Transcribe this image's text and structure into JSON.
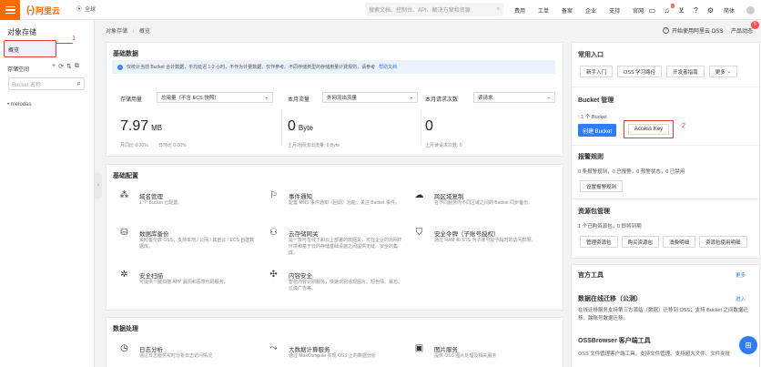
{
  "topbar": {
    "logo_text": "阿里云",
    "region": "全球",
    "search_placeholder": "搜索文档、控制台、API、解决方案和资源",
    "nav": [
      "费用",
      "工单",
      "备案",
      "企业",
      "支持",
      "官网"
    ],
    "notification_count": "1",
    "lang": "简体"
  },
  "sidebar": {
    "title": "对象存储",
    "overview_label": "概览",
    "annotation": "1",
    "bucket_list_label": "存储空间",
    "bucket_search_placeholder": "Bucket 名称",
    "bucket_entry": "melodas"
  },
  "breadcrumb": {
    "root": "对象存储",
    "sep": "/",
    "current": "概览",
    "right_link": "开始使用阿里云 OSS",
    "product_trends": "产品动态",
    "product_badge": "5"
  },
  "basic_data": {
    "title": "基础数据",
    "info": "仅统计当前 Bucket 合计数据，平均延迟 1-2 小时，不作为计量数据，仅作参考。不同存储类型的存储用量计费规则，请参考",
    "info_link": "帮助文档",
    "storage": {
      "label": "存储用量",
      "select": "总用量（不含 ECS 快照）",
      "value": "7.97",
      "unit": "MB",
      "sub1": "月同比 0.00%",
      "sub2": "日环比 0.00%"
    },
    "traffic": {
      "label": "本月流量",
      "select": "外网流出流量",
      "value": "0",
      "unit": "Byte",
      "sub": "上月外网流出流量: 0 Byte"
    },
    "requests": {
      "label": "本月请求次数",
      "select": "读请求",
      "value": "0",
      "sub": "上月读请求次数: 0"
    }
  },
  "basic_config": {
    "title": "基础配置",
    "features": [
      {
        "name": "域名管理",
        "desc": "1 个 Bucket 已配置。",
        "icon": "network-icon"
      },
      {
        "name": "事件通知",
        "desc": "配置 MNS 事件通知（回调）功能，关注 Bucket 事件。",
        "icon": "notification-icon"
      },
      {
        "name": "跨区域复制",
        "desc": "在不同服务内不同区域之间的 Bucket 同步备份。",
        "icon": "cloud-sync-icon"
      },
      {
        "name": "数据库备份",
        "desc": "实时备份数 OSS，支持本地 / 公网 / 其他云 / ECS 自建数据库。",
        "icon": "database-backup-icon"
      },
      {
        "name": "云存储网关",
        "desc": "是一款可在线下和云上部署的软网关，可在企业的内网IT环境和基于云的存储基础设施之间提供无缝、安全的集成。",
        "icon": "gateway-icon"
      },
      {
        "name": "安全令牌（子账号授权）",
        "desc": "通过 RAM 和 STS 为子账号授予临时的访问权限。",
        "icon": "security-token-icon"
      },
      {
        "name": "安全扫描",
        "desc": "可提供一键扫描 APP 漏洞和恶意代码服务。",
        "icon": "security-scan-icon"
      },
      {
        "name": "内容安全",
        "desc": "智能内容识别服务，快速识别违规图片、短色情、暴恐、垃圾广告等。",
        "icon": "content-security-icon"
      }
    ]
  },
  "data_processing": {
    "title": "数据处理",
    "features": [
      {
        "name": "日志分析",
        "desc": "通过日志服务实时分析日志访问情况",
        "icon": "log-analysis-icon"
      },
      {
        "name": "大数据计算服务",
        "desc": "通过 MaxCompute 实现 OSS 上的数据分析",
        "icon": "bigdata-icon"
      },
      {
        "name": "图片服务",
        "desc": "提供 OSS 图片处理及相关服务",
        "icon": "image-service-icon"
      }
    ]
  },
  "right_panel": {
    "common_entry_title": "常用入口",
    "quick_buttons": [
      "新手入门",
      "OSS 学习路径",
      "开发者指南",
      "更多"
    ],
    "bucket_mgmt_title": "Bucket 管理",
    "bucket_count": "1 个 Bucket",
    "create_bucket": "创建 Bucket",
    "access_key": "Access Key",
    "annotation": "2",
    "alarm_title": "报警规则",
    "alarm_status": "0 条报警规则，0 已报警，0 预警状态，0 已禁用",
    "alarm_button": "设置报警规则",
    "resource_title": "资源包管理",
    "resource_status": "1 个已购资源包，0 即将到期",
    "resource_buttons": [
      "管理资源包",
      "购买资源包",
      "消费明细",
      "资源包使用明细"
    ],
    "tools_title": "官方工具",
    "tools_more": "更多",
    "migration_title": "数据在线迁移（公测）",
    "migration_enter": "进入",
    "migration_desc": "在线迁移服务支持第三方源站（数据）迁移到 OSS；支持 Bucket 之间数据迁移、跨账号数据迁移。",
    "ossbrowser_title": "OSSBrowser 客户端工具",
    "ossbrowser_desc": "OSS 文件管理客户端工具，支持文件管理、支持超大文件、文件夹批"
  }
}
